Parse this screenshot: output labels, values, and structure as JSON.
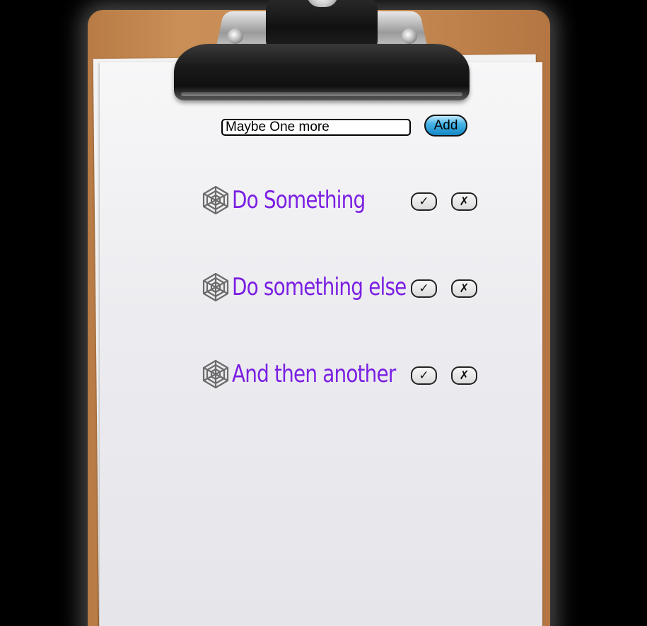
{
  "form": {
    "input_value": "Maybe One more",
    "add_label": "Add"
  },
  "tasks": [
    {
      "label": "Do Something",
      "complete_label": "✓",
      "delete_label": "✗",
      "icon": "spider-web-icon"
    },
    {
      "label": "Do something else",
      "complete_label": "✓",
      "delete_label": "✗",
      "icon": "spider-web-icon"
    },
    {
      "label": "And then another",
      "complete_label": "✓",
      "delete_label": "✗",
      "icon": "spider-web-icon"
    }
  ],
  "colors": {
    "task_text": "#7b1fe2",
    "add_button": "#1287c7",
    "clipboard": "#c88c55",
    "background": "#000000"
  }
}
